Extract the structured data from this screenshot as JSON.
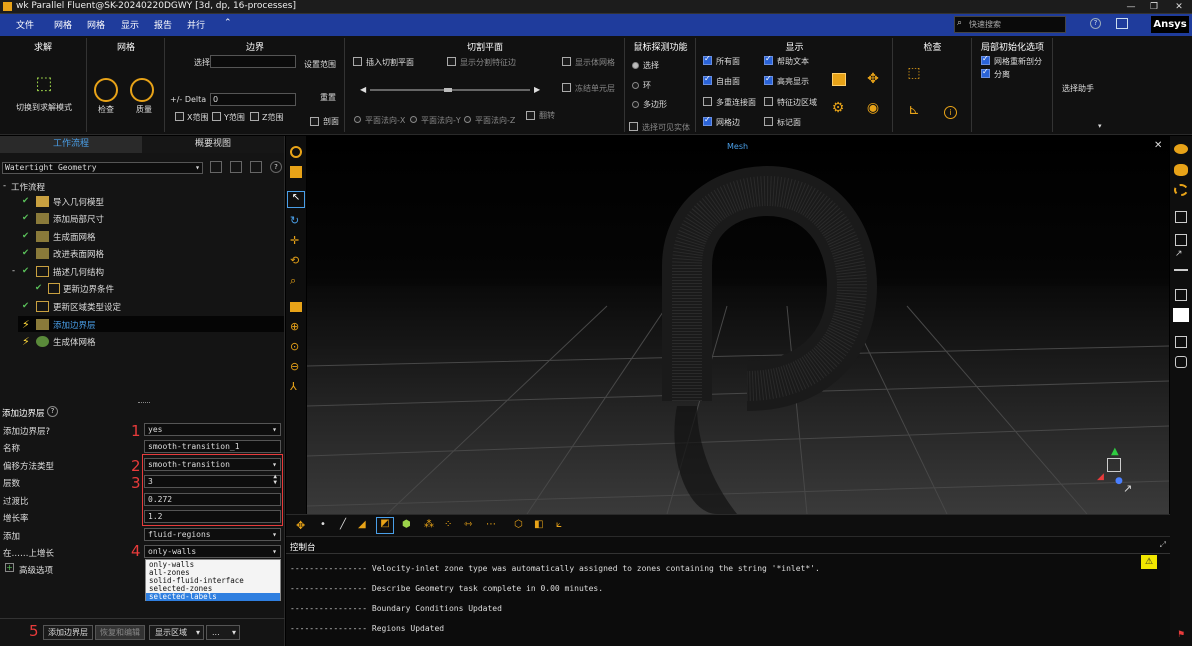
{
  "title": "wk Parallel Fluent@SK-20240220DGWY  [3d, dp, 16-processes]",
  "menu": [
    "文件",
    "网格",
    "网格",
    "显示",
    "报告",
    "并行",
    "⌃"
  ],
  "search_placeholder": "快速搜索",
  "brand": "Ansys",
  "ribbon": {
    "solve": {
      "title": "求解",
      "switch": "切换到求解模式"
    },
    "mesh": {
      "title": "网格",
      "check": "检查",
      "quality": "质量"
    },
    "boundary": {
      "title": "边界",
      "select": "选择",
      "set_range": "设置范围",
      "delta": "+/- Delta",
      "delta_val": "0",
      "reset": "重置",
      "x": "X范围",
      "y": "Y范围",
      "z": "Z范围",
      "cut": "剖面"
    },
    "clip": {
      "title": "切割平面",
      "insert": "插入切割平面",
      "show_clip_edge": "显示分割特征边",
      "show_volume": "显示体网格",
      "freeze": "冻结单元层",
      "flip": "翻转",
      "px": "平面法向-X",
      "py": "平面法向-Y",
      "pz": "平面法向-Z"
    },
    "probe": {
      "title": "鼠标探测功能",
      "select": "选择",
      "ring": "环",
      "polygon": "多边形",
      "select_visible": "选择可见实体"
    },
    "display": {
      "title": "显示",
      "all_faces": "所有面",
      "help_text": "帮助文本",
      "free_faces": "自由面",
      "highlight": "高亮显示",
      "multi_conn": "多重连接面",
      "feature_region": "特征边区域",
      "mesh_edges": "网格边",
      "mark_faces": "标记面"
    },
    "inspect": {
      "title": "检查"
    },
    "local_init": {
      "title": "局部初始化选项",
      "remesh": "网格重新剖分",
      "split": "分离"
    },
    "select_helper": "选择助手"
  },
  "left": {
    "tabs": [
      "工作流程",
      "概要视图"
    ],
    "workflow_type": "Watertight Geometry",
    "tree_root": "工作流程",
    "steps": [
      "导入几何模型",
      "添加局部尺寸",
      "生成面网格",
      "改进表面网格",
      "描述几何结构",
      "更新边界条件",
      "更新区域类型设定",
      "添加边界层",
      "生成体网格"
    ],
    "form_title": "添加边界层",
    "fields": [
      {
        "label": "添加边界层?",
        "value": "yes"
      },
      {
        "label": "名称",
        "value": "smooth-transition_1"
      },
      {
        "label": "偏移方法类型",
        "value": "smooth-transition"
      },
      {
        "label": "层数",
        "value": "3"
      },
      {
        "label": "过渡比",
        "value": "0.272"
      },
      {
        "label": "增长率",
        "value": "1.2"
      },
      {
        "label": "添加",
        "value": "fluid-regions"
      },
      {
        "label": "在……上增长",
        "value": "only-walls"
      }
    ],
    "dropdown_options": [
      "only-walls",
      "all-zones",
      "solid-fluid-interface",
      "selected-zones",
      "selected-labels"
    ],
    "advanced": "高级选项",
    "buttons": [
      "添加边界层",
      "恢复和编辑",
      "显示区域",
      "..."
    ],
    "markers": [
      "1",
      "2",
      "3",
      "4",
      "5"
    ]
  },
  "viewport": {
    "label": "Mesh"
  },
  "console": {
    "title": "控制台",
    "lines": [
      "---------------- Velocity-inlet zone type was automatically assigned to zones containing the string '*inlet*'.",
      "---------------- Describe Geometry task complete in  0.00 minutes.",
      "---------------- Boundary Conditions Updated",
      "---------------- Regions Updated"
    ]
  }
}
